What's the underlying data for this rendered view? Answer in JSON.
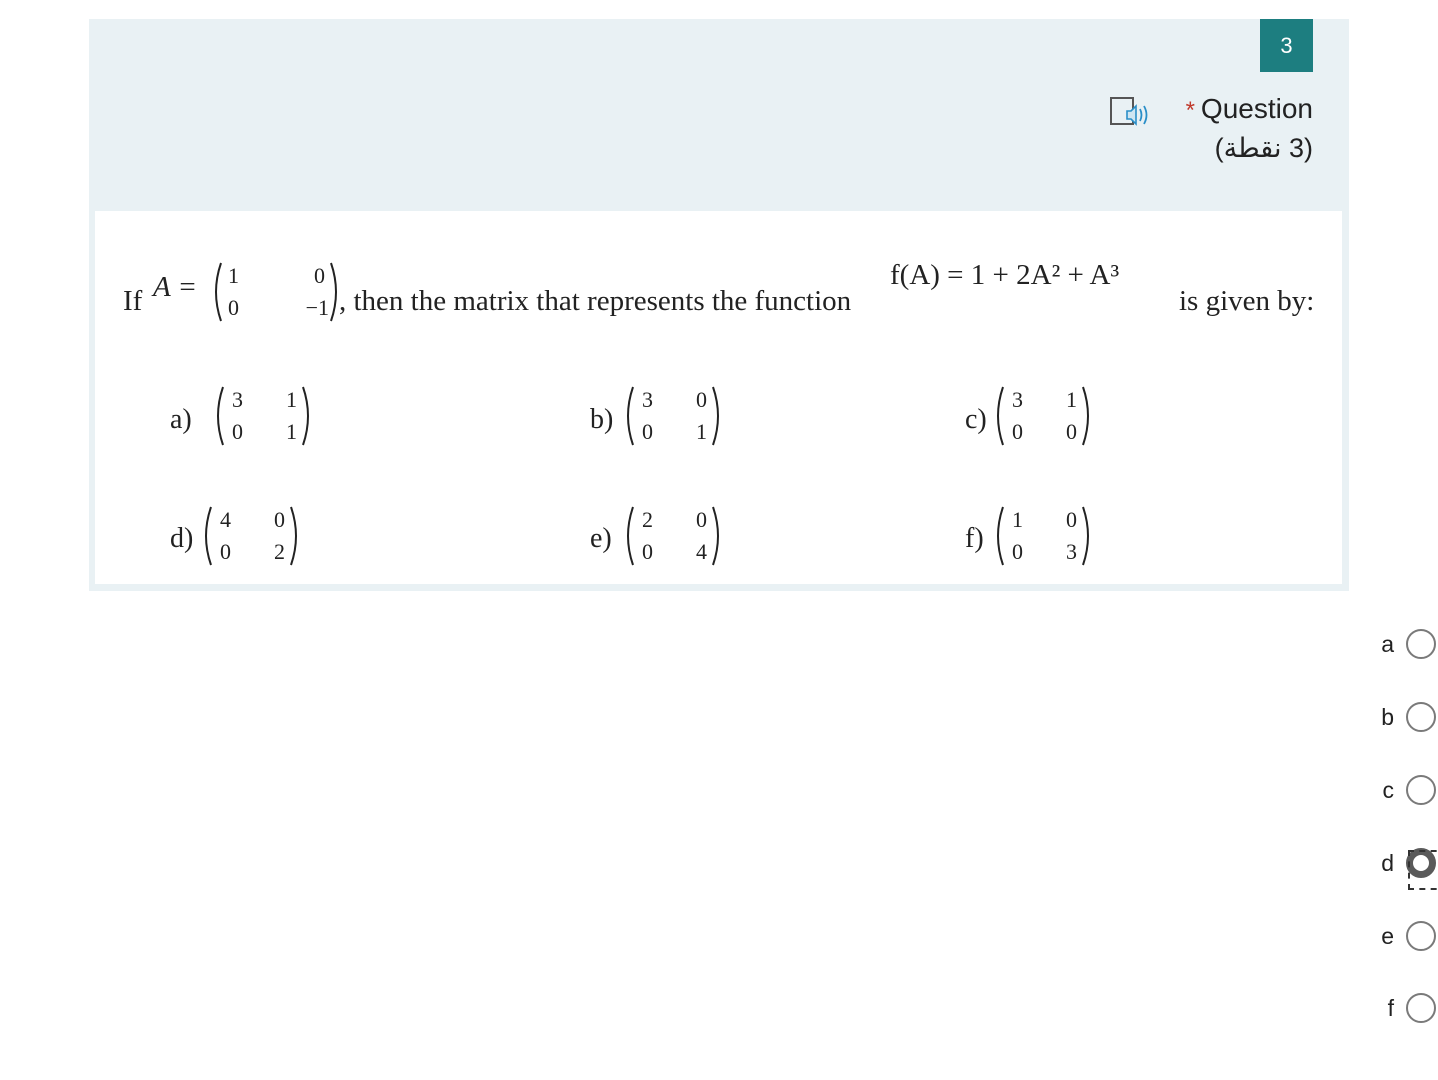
{
  "question": {
    "number": "3",
    "required_mark": "*",
    "title": "Question",
    "points": "(3 نقطة)",
    "audio_icon": "immersive-reader-icon"
  },
  "stem": {
    "if": "If",
    "a_eq": "A =",
    "matrix_A": [
      "1",
      "0",
      "0",
      "−1"
    ],
    "mid_text": ", then the matrix that represents the function",
    "function": "f(A) = 1 + 2A² + A³",
    "end_text": "is given by:"
  },
  "options": [
    {
      "label": "a)",
      "matrix": [
        "3",
        "1",
        "0",
        "1"
      ]
    },
    {
      "label": "b)",
      "matrix": [
        "3",
        "0",
        "0",
        "1"
      ]
    },
    {
      "label": "c)",
      "matrix": [
        "3",
        "1",
        "0",
        "0"
      ]
    },
    {
      "label": "d)",
      "matrix": [
        "4",
        "0",
        "0",
        "2"
      ]
    },
    {
      "label": "e)",
      "matrix": [
        "2",
        "0",
        "0",
        "4"
      ]
    },
    {
      "label": "f)",
      "matrix": [
        "1",
        "0",
        "0",
        "3"
      ]
    }
  ],
  "answers": [
    {
      "label": "a",
      "selected": false
    },
    {
      "label": "b",
      "selected": false
    },
    {
      "label": "c",
      "selected": false
    },
    {
      "label": "d",
      "selected": true
    },
    {
      "label": "e",
      "selected": false
    },
    {
      "label": "f",
      "selected": false
    }
  ],
  "colors": {
    "card_bg": "#e9f1f4",
    "number_badge": "#1d7e80",
    "required": "#c0392b"
  }
}
